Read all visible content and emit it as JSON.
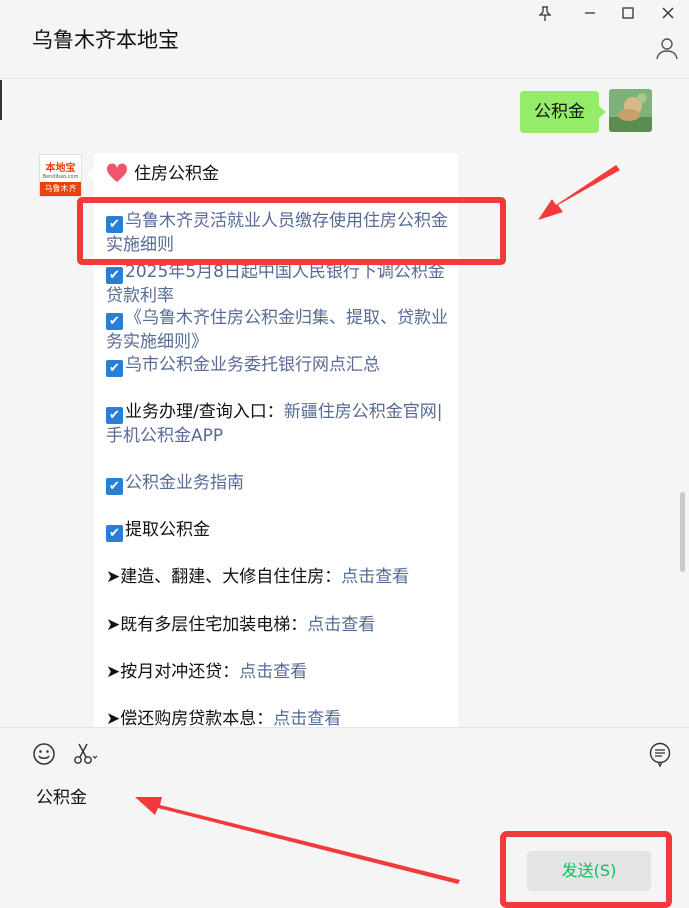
{
  "window": {
    "title": "乌鲁木齐本地宝",
    "controls": [
      "pin-icon",
      "minimize-icon",
      "maximize-icon",
      "close-icon"
    ]
  },
  "messages": {
    "sent": {
      "text": "公积金"
    },
    "received": {
      "avatar": {
        "brand": "本地宝",
        "url": "Bendibao.com",
        "city": "乌鲁木齐"
      },
      "header": "住房公积金",
      "items": [
        {
          "text": "乌鲁木齐灵活就业人员缴存使用住房公积金实施细则"
        },
        {
          "text": "2025年5月8日起中国人民银行下调公积金贷款利率"
        },
        {
          "text": "《乌鲁木齐住房公积金归集、提取、贷款业务实施细则》"
        },
        {
          "text": "乌市公积金业务委托银行网点汇总"
        },
        {
          "label": "业务办理/查询入口：",
          "text": "新疆住房公积金官网|手机公积金APP"
        },
        {
          "text": "公积金业务指南"
        },
        {
          "label": "提取公积金"
        }
      ],
      "arrow_items": [
        {
          "label": "➤建造、翻建、大修自住住房：",
          "link": "点击查看"
        },
        {
          "label": "➤既有多层住宅加装电梯：",
          "link": "点击查看"
        },
        {
          "label": "➤按月对冲还贷：",
          "link": "点击查看"
        },
        {
          "label": "➤偿还购房贷款本息：",
          "link": "点击查看"
        }
      ]
    }
  },
  "input": {
    "value": "公积金",
    "send_label": "发送(S)"
  },
  "colors": {
    "sent_bubble": "#95ec69",
    "link": "#576b95",
    "annotation": "#f33a3a",
    "send_text": "#07c160"
  }
}
